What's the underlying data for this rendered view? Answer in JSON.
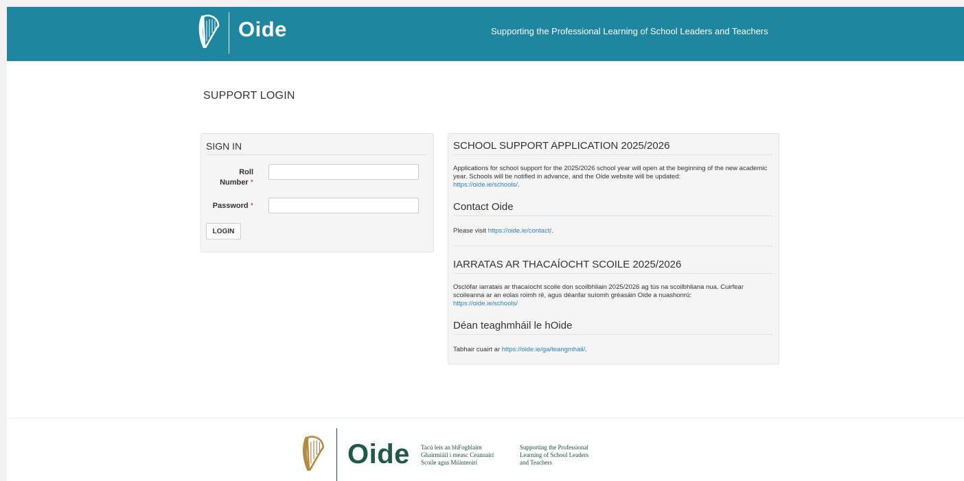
{
  "header": {
    "logo_text": "Oide",
    "tagline": "Supporting the Professional Learning of School Leaders and Teachers"
  },
  "page_title": "SUPPORT LOGIN",
  "signin": {
    "title": "SIGN IN",
    "roll_label_1": "Roll",
    "roll_label_2": "Number",
    "password_label": "Password",
    "required_mark": "*",
    "roll_value": "",
    "password_value": "",
    "login_button": "LOGIN"
  },
  "info": {
    "en_heading": "SCHOOL SUPPORT APPLICATION 2025/2026",
    "en_text": "Applications for school support for the 2025/2026 school year will open at the beginning of the new academic year. Schools will be notified in advance, and the Oide website will be updated:",
    "en_link": "https://oide.ie/schools/",
    "en_link_suffix": ".",
    "contact_heading": "Contact Oide",
    "contact_prefix": "Please visit ",
    "contact_link": "https://oide.ie/contact/",
    "contact_suffix": ".",
    "ga_heading": "IARRATAS AR THACAÍOCHT SCOILE 2025/2026",
    "ga_text": "Osclófar iarratais ar thacaíocht scoile don scoilbhliain 2025/2026 ag tús na scoilbhliana nua. Cuirfear scoileanna ar an eolas roimh ré, agus déanfar suíomh gréasáin Oide a nuashonrú:",
    "ga_link": "https://oide.ie/schools/",
    "ga_contact_heading": "Déan teaghmháil le hOide",
    "ga_contact_prefix": "Tabhair cuairt ar ",
    "ga_contact_link": "https://oide.ie/ga/teangmhail/",
    "ga_contact_suffix": "."
  },
  "footer": {
    "logo_text": "Oide",
    "irish_tagline": "Tacú leis an bhFoghlaim\nGhairmiúil i measc Ceannairí\nScoile agus Múinteoirí",
    "english_tagline": "Supporting the Professional\nLearning of School Leaders\nand Teachers"
  },
  "colors": {
    "header_bg": "#1f86a0",
    "link": "#2a7fc1",
    "footer_green": "#1e5a47",
    "harp_gold": "#b58a3c"
  }
}
